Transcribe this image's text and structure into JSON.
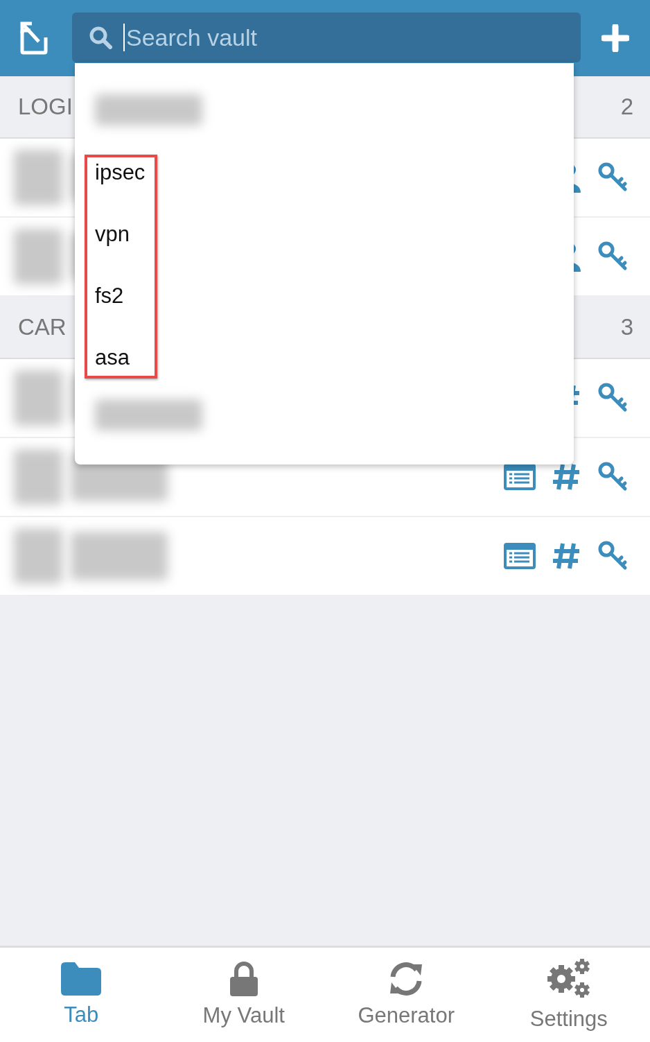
{
  "header": {
    "search": {
      "placeholder": "Search vault"
    }
  },
  "suggestions": [
    {
      "kind": "redacted"
    },
    {
      "kind": "group",
      "highlighted": true,
      "items": [
        "ipsec",
        "vpn",
        "fs2",
        "asa"
      ]
    },
    {
      "kind": "redacted"
    }
  ],
  "sections": [
    {
      "title": "LOGI",
      "count": "2",
      "rows": [
        {
          "kind": "login"
        },
        {
          "kind": "login"
        }
      ]
    },
    {
      "title": "CAR",
      "count": "3",
      "rows": [
        {
          "kind": "card_covered"
        },
        {
          "kind": "card"
        },
        {
          "kind": "card"
        }
      ]
    }
  ],
  "tabs": [
    {
      "label": "Tab",
      "selected": true
    },
    {
      "label": "My Vault",
      "selected": false
    },
    {
      "label": "Generator",
      "selected": false
    },
    {
      "label": "Settings",
      "selected": false
    }
  ]
}
